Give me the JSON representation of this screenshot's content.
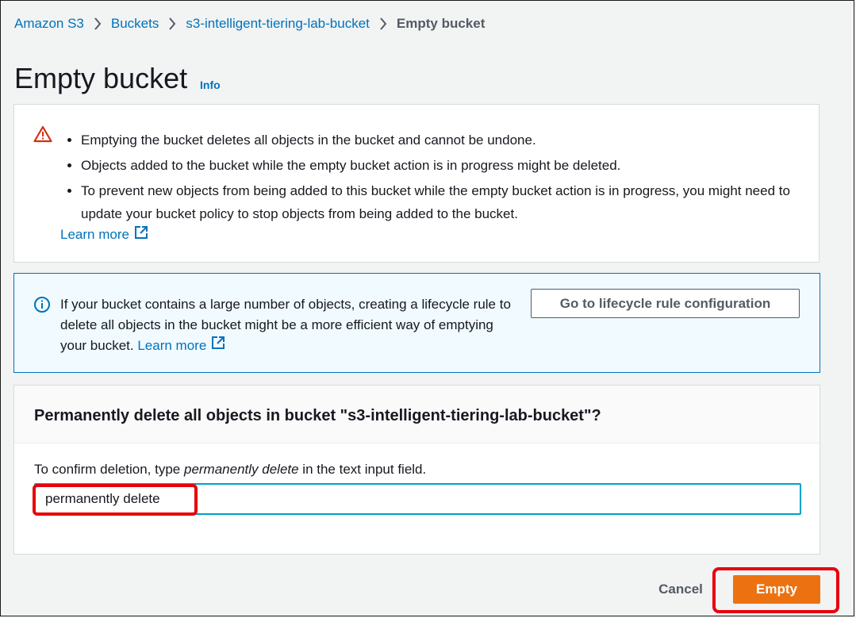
{
  "breadcrumb": {
    "items": [
      "Amazon S3",
      "Buckets",
      "s3-intelligent-tiering-lab-bucket"
    ],
    "current": "Empty bucket"
  },
  "page": {
    "title": "Empty bucket",
    "info_link": "Info"
  },
  "warning": {
    "bullets": [
      "Emptying the bucket deletes all objects in the bucket and cannot be undone.",
      "Objects added to the bucket while the empty bucket action is in progress might be deleted.",
      "To prevent new objects from being added to this bucket while the empty bucket action is in progress, you might need to update your bucket policy to stop objects from being added to the bucket."
    ],
    "learn_more": "Learn more",
    "icon": "warning-icon",
    "color": "#d13212"
  },
  "info_alert": {
    "text": "If your bucket contains a large number of objects, creating a lifecycle rule to delete all objects in the bucket might be a more efficient way of emptying your bucket.",
    "learn_more": "Learn more",
    "button_label": "Go to lifecycle rule configuration",
    "icon": "info-icon",
    "color": "#0073bb"
  },
  "confirm": {
    "title": "Permanently delete all objects in bucket \"s3-intelligent-tiering-lab-bucket\"?",
    "instruction_prefix": "To confirm deletion, type ",
    "instruction_emphasis": "permanently delete",
    "instruction_suffix": " in the text input field.",
    "input_value": "permanently delete"
  },
  "footer": {
    "cancel_label": "Cancel",
    "empty_label": "Empty",
    "primary_color": "#ec7211",
    "highlight_color": "#e8000b"
  }
}
